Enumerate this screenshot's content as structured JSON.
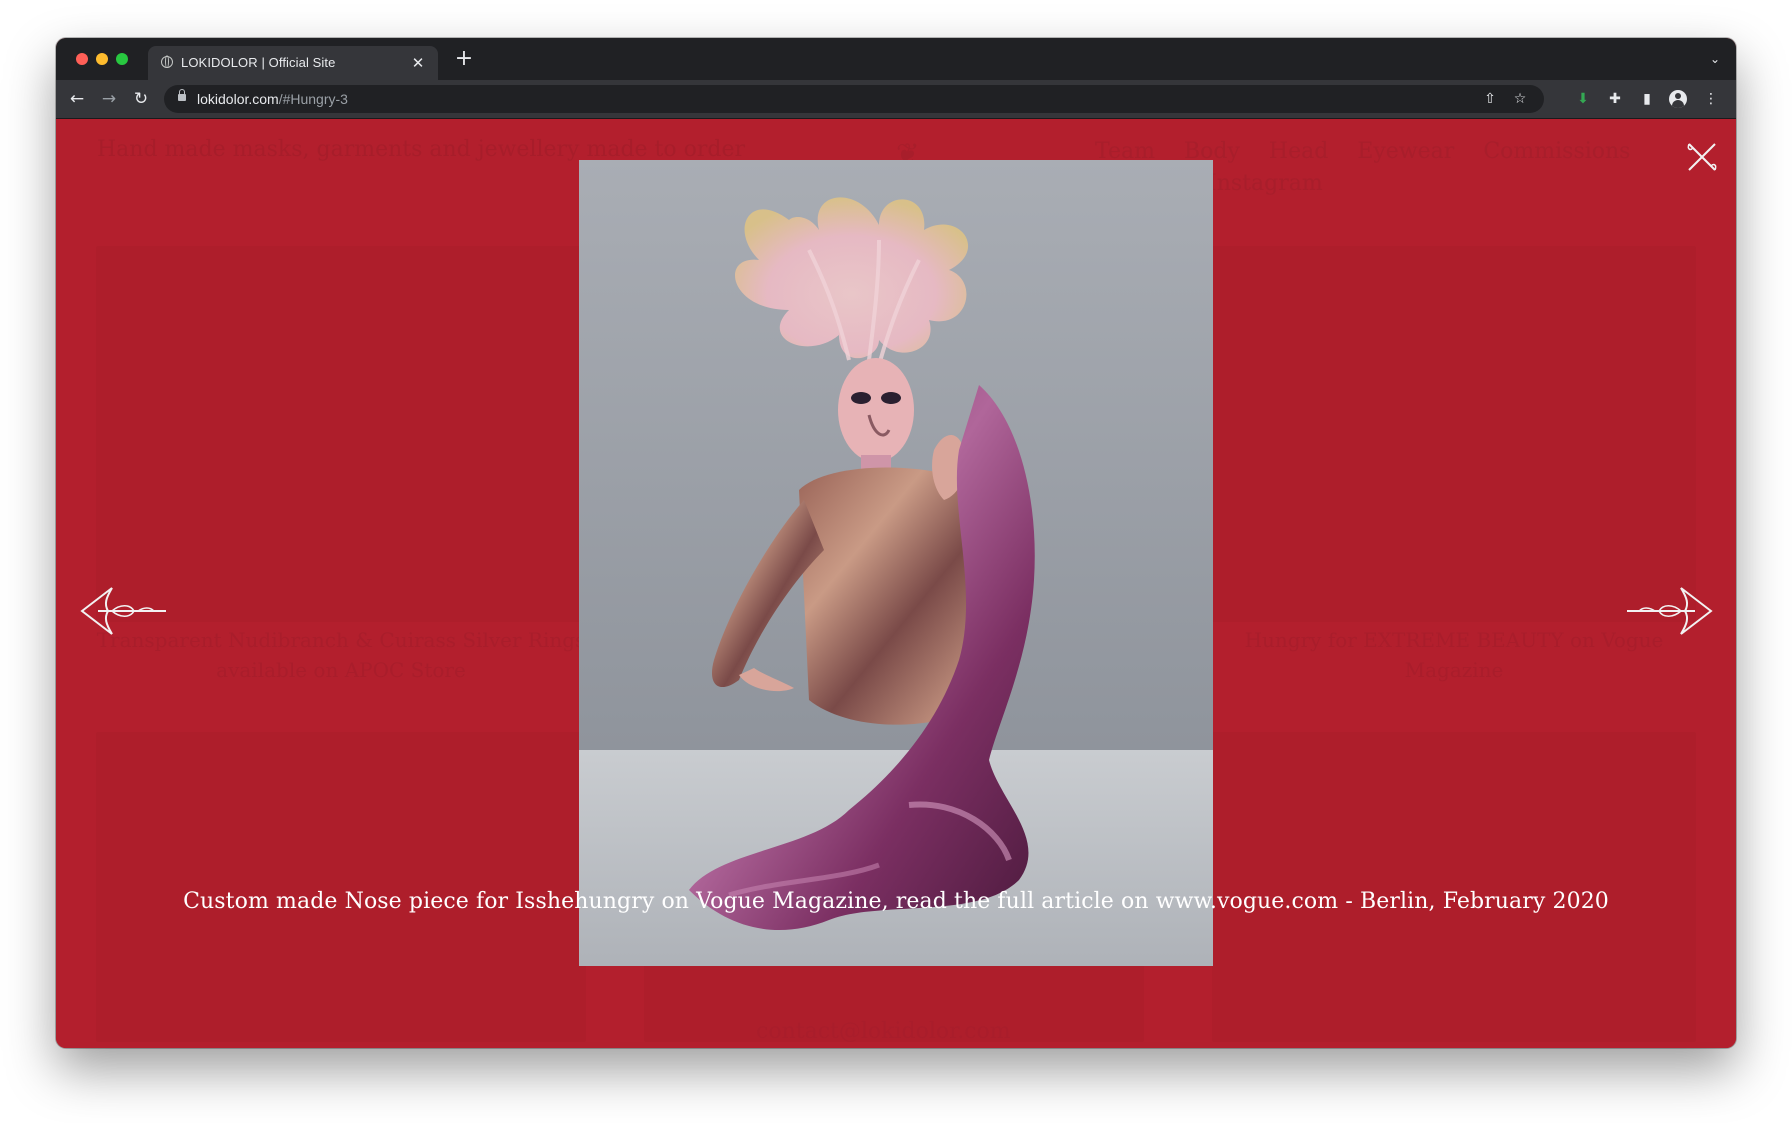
{
  "browser": {
    "tab_title": "LOKIDOLOR | Official Site",
    "tab_close": "✕",
    "new_tab": "+",
    "url_host": "lokidolor.com",
    "url_path": "/#Hungry-3"
  },
  "page_background": {
    "tagline": "Hand made masks, garments and jewellery made to order",
    "nav": [
      "Team",
      "Body",
      "Head",
      "Eyewear",
      "Commissions"
    ],
    "nav_second_line": "Instagram",
    "card_left_caption": "Transparent Nudibranch & Cuirass Silver Rings available on APOC Store",
    "card_right_caption": "Hungry for EXTREME BEAUTY on Vogue Magazine",
    "contact": "contact@lokidolor.com"
  },
  "lightbox": {
    "caption": "Custom made Nose piece for Isshehungry on Vogue Magazine, read the full article on www.vogue.com - Berlin, February 2020"
  },
  "colors": {
    "page_red": "#b3202e",
    "chrome_dark": "#202124",
    "chrome_toolbar": "#35363a"
  },
  "icons": {
    "back": "←",
    "forward": "→",
    "reload": "↻",
    "share": "⇧",
    "star": "☆",
    "download": "⬇",
    "extensions": "✚",
    "side_panel": "▮",
    "menu": "⋮",
    "tab_list": "⌄"
  }
}
